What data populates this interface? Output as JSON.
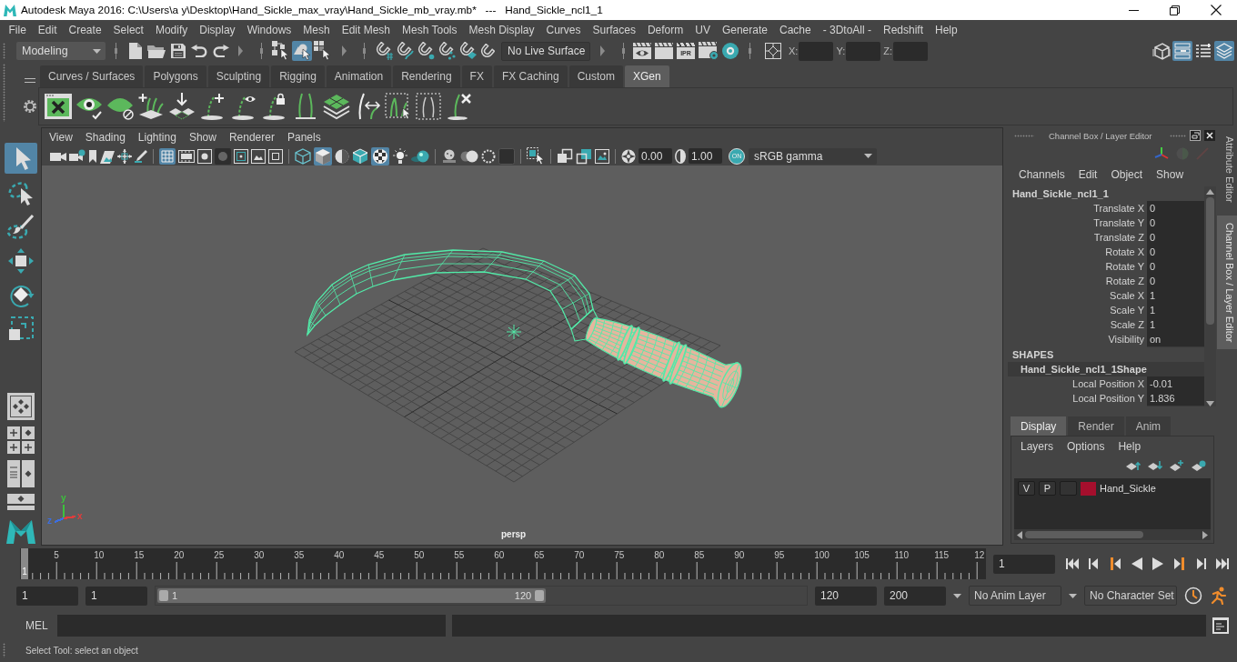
{
  "window": {
    "title": "Autodesk Maya 2016: C:\\Users\\a y\\Desktop\\Hand_Sickle_max_vray\\Hand_Sickle_mb_vray.mb*   ---   Hand_Sickle_ncl1_1"
  },
  "menu_bar": [
    "File",
    "Edit",
    "Create",
    "Select",
    "Modify",
    "Display",
    "Windows",
    "Mesh",
    "Edit Mesh",
    "Mesh Tools",
    "Mesh Display",
    "Curves",
    "Surfaces",
    "Deform",
    "UV",
    "Generate",
    "Cache",
    "- 3DtoAll -",
    "Redshift",
    "Help"
  ],
  "status_line": {
    "menu_set": "Modeling",
    "selection_mask": [
      {
        "kind": "hierarchy",
        "selected": false
      },
      {
        "kind": "object",
        "selected": true
      },
      {
        "kind": "component",
        "selected": false
      }
    ],
    "live_surface": "No Live Surface",
    "ipr": "IPR",
    "coordinates": [
      "X:",
      "Y:",
      "Z:"
    ],
    "panels": [
      {
        "kind": "toolkit",
        "on": false
      },
      {
        "kind": "attributes",
        "on": true
      },
      {
        "kind": "settings",
        "on": false
      },
      {
        "kind": "channels",
        "on": true
      }
    ]
  },
  "shelf": {
    "tabs": [
      {
        "label": "Curves / Surfaces",
        "selected": false
      },
      {
        "label": "Polygons",
        "selected": false
      },
      {
        "label": "Sculpting",
        "selected": false
      },
      {
        "label": "Rigging",
        "selected": false
      },
      {
        "label": "Animation",
        "selected": false
      },
      {
        "label": "Rendering",
        "selected": false
      },
      {
        "label": "FX",
        "selected": false
      },
      {
        "label": "FX Caching",
        "selected": false
      },
      {
        "label": "Custom",
        "selected": false
      },
      {
        "label": "XGen",
        "selected": true
      }
    ]
  },
  "toolbox": {
    "tools": [
      {
        "kind": "select",
        "selected": true
      },
      {
        "kind": "lasso",
        "selected": false
      },
      {
        "kind": "paint",
        "selected": false
      },
      {
        "kind": "move",
        "selected": false
      },
      {
        "kind": "rotate",
        "selected": false
      },
      {
        "kind": "scale",
        "selected": false
      }
    ]
  },
  "viewport": {
    "menu": [
      "View",
      "Shading",
      "Lighting",
      "Show",
      "Renderer",
      "Panels"
    ],
    "toolbar": [
      [
        {
          "kind": "camera",
          "on": false
        },
        {
          "kind": "attributes",
          "on": false
        },
        {
          "kind": "bookmark",
          "on": false
        },
        {
          "kind": "imageplane",
          "on": false
        },
        {
          "kind": "panzoom",
          "on": false
        },
        {
          "kind": "pencil",
          "on": false
        }
      ],
      [
        {
          "kind": "grid",
          "on": true
        },
        {
          "kind": "filmgate",
          "on": false
        },
        {
          "kind": "resgate",
          "on": false
        },
        {
          "kind": "gatemask",
          "on": false
        },
        {
          "kind": "fieldchart",
          "on": false
        },
        {
          "kind": "safeaction",
          "on": false
        },
        {
          "kind": "safetitle",
          "on": false
        }
      ],
      [
        {
          "kind": "wireframe",
          "on": false
        },
        {
          "kind": "shaded",
          "on": true
        },
        {
          "kind": "wireshaded",
          "on": false
        },
        {
          "kind": "textured",
          "on": false
        },
        {
          "kind": "checker",
          "on": true
        },
        {
          "kind": "lights",
          "on": false
        },
        {
          "kind": "shadows",
          "on": false
        }
      ],
      [
        {
          "kind": "occlusion",
          "on": false
        },
        {
          "kind": "motionblur",
          "on": false
        },
        {
          "kind": "antialias",
          "on": false
        },
        {
          "kind": "dof",
          "on": false
        }
      ],
      [
        {
          "kind": "isolate",
          "on": false
        }
      ],
      [
        {
          "kind": "xray",
          "on": false
        },
        {
          "kind": "xrayjoints",
          "on": false
        },
        {
          "kind": "xraycomponents",
          "on": false
        }
      ]
    ],
    "exposure": "0.00",
    "gamma": "1.00",
    "color_management": "ON",
    "view_transform": "sRGB gamma",
    "axes": [
      {
        "label": "y",
        "color": "#3dc13d"
      },
      {
        "label": "z",
        "color": "#3c6ee0"
      },
      {
        "label": "x",
        "color": "#e03c3c"
      }
    ],
    "camera": "persp"
  },
  "channel_box": {
    "title": "Channel Box / Layer Editor",
    "menu": [
      "Channels",
      "Edit",
      "Object",
      "Show"
    ],
    "object": "Hand_Sickle_ncl1_1",
    "attributes": [
      {
        "name": "Translate X",
        "value": "0"
      },
      {
        "name": "Translate Y",
        "value": "0"
      },
      {
        "name": "Translate Z",
        "value": "0"
      },
      {
        "name": "Rotate X",
        "value": "0"
      },
      {
        "name": "Rotate Y",
        "value": "0"
      },
      {
        "name": "Rotate Z",
        "value": "0"
      },
      {
        "name": "Scale X",
        "value": "1"
      },
      {
        "name": "Scale Y",
        "value": "1"
      },
      {
        "name": "Scale Z",
        "value": "1"
      },
      {
        "name": "Visibility",
        "value": "on"
      }
    ],
    "shapes_heading": "SHAPES",
    "shape": "Hand_Sickle_ncl1_1Shape",
    "shape_attributes": [
      {
        "name": "Local Position X",
        "value": "-0.01"
      },
      {
        "name": "Local Position Y",
        "value": "1.836"
      }
    ]
  },
  "layer_editor": {
    "tabs": [
      {
        "label": "Display",
        "selected": true
      },
      {
        "label": "Render",
        "selected": false
      },
      {
        "label": "Anim",
        "selected": false
      }
    ],
    "menu": [
      "Layers",
      "Options",
      "Help"
    ],
    "layers": [
      {
        "visibility": "V",
        "playback": "P",
        "color": "#a50f2d",
        "name": "Hand_Sickle"
      }
    ]
  },
  "side_tabs": [
    {
      "label": "Attribute Editor",
      "selected": false
    },
    {
      "label": "Channel Box / Layer Editor",
      "selected": true
    }
  ],
  "time_slider": {
    "frame_labels": [
      "5",
      "10",
      "15",
      "20",
      "25",
      "30",
      "35",
      "40",
      "45",
      "50",
      "55",
      "60",
      "65",
      "70",
      "75",
      "80",
      "85",
      "90",
      "95",
      "100",
      "105",
      "110",
      "115",
      "12"
    ],
    "current_frame": "1",
    "level": 0,
    "frame_field": "1"
  },
  "range_slider": {
    "start": "1",
    "range_start": "1",
    "handle_start": "1",
    "handle_end": "120",
    "level": 0.6,
    "range_end": "120",
    "end": "200",
    "anim_layer": "No Anim Layer",
    "character_set": "No Character Set"
  },
  "command_line": {
    "language": "MEL"
  },
  "help_line": "Select Tool: select an object"
}
